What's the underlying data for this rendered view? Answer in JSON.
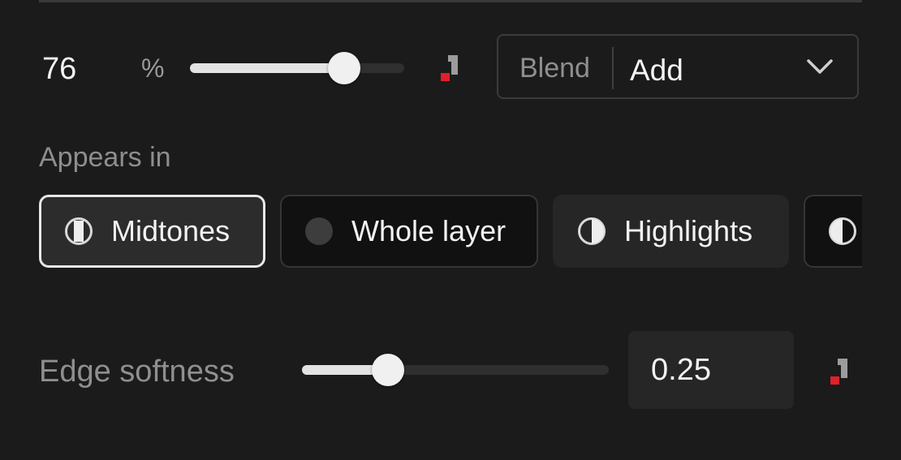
{
  "opacity": {
    "value": "76",
    "unit": "%",
    "slider_fraction": 0.72
  },
  "blend": {
    "label": "Blend",
    "value": "Add"
  },
  "appears_in": {
    "label": "Appears in",
    "options": [
      {
        "label": "Midtones",
        "icon": "midtones-icon",
        "selected": true
      },
      {
        "label": "Whole layer",
        "icon": "whole-layer-icon",
        "selected": false
      },
      {
        "label": "Highlights",
        "icon": "highlights-icon",
        "selected": false
      },
      {
        "label": "",
        "icon": "shadows-icon",
        "selected": false
      }
    ]
  },
  "edge_softness": {
    "label": "Edge softness",
    "value": "0.25",
    "slider_fraction": 0.28
  },
  "colors": {
    "background": "#1b1b1b",
    "keyframe_accent": "#e0202a",
    "selected_border": "#e7e7e7"
  }
}
